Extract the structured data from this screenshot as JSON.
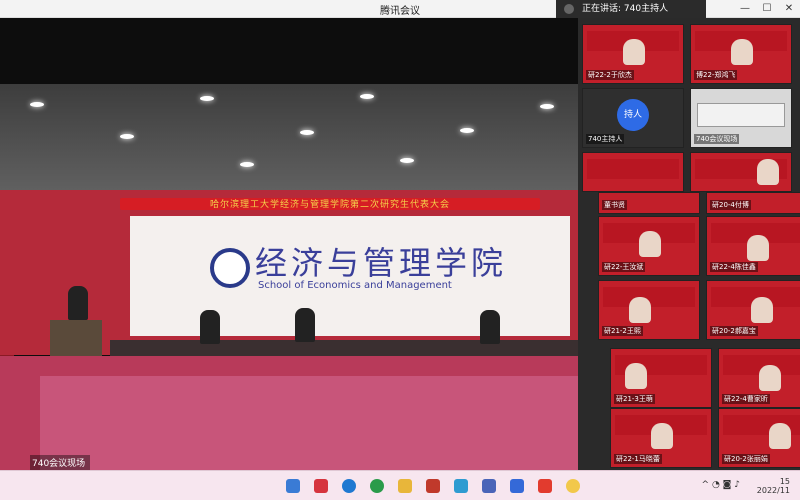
{
  "window": {
    "title": "腾讯会议",
    "speaking_prefix": "正在讲话:",
    "speaking_name": "740主持人"
  },
  "main_video": {
    "banner_text": "哈尔滨理工大学经济与管理学院第二次研究生代表大会",
    "school_cn": "经济与管理学院",
    "school_en": "School of Economics and Management",
    "label": "740会议现场"
  },
  "participants": [
    {
      "label": "研22-2于欣杰"
    },
    {
      "label": "博22-郑鸿飞"
    },
    {
      "label": "740主持人",
      "avatar_text": "持人"
    },
    {
      "label": "740会议现场"
    },
    {
      "label": ""
    },
    {
      "label": ""
    },
    {
      "label": "董书贤"
    },
    {
      "label": "研20-4付博"
    },
    {
      "label": "研22-王汝斌"
    },
    {
      "label": "研22-4陈佳鑫"
    },
    {
      "label": "研21-2王熙"
    },
    {
      "label": "研20-2郝嘉宝"
    },
    {
      "label": "研21-3王萌"
    },
    {
      "label": "研22-4曹家昕"
    },
    {
      "label": "研22-1马晓蕾"
    },
    {
      "label": "研20-2张丽娟"
    }
  ],
  "taskbar": {
    "tray_time": "15",
    "tray_date": "2022/11"
  },
  "colors": {
    "accent_red": "#c21f2a",
    "host_blue": "#2e6be6"
  }
}
